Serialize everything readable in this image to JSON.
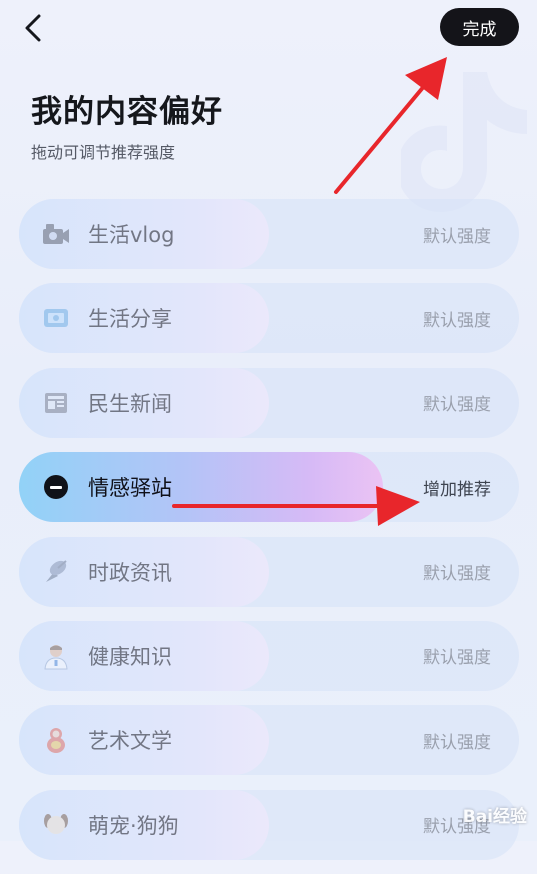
{
  "header": {
    "done_label": "完成"
  },
  "page": {
    "title": "我的内容偏好",
    "subtitle": "拖动可调节推荐强度"
  },
  "preferences": [
    {
      "label": "生活vlog",
      "strength": "默认强度",
      "icon": "camera-icon",
      "active": false
    },
    {
      "label": "生活分享",
      "strength": "默认强度",
      "icon": "photo-share-icon",
      "active": false
    },
    {
      "label": "民生新闻",
      "strength": "默认强度",
      "icon": "newspaper-icon",
      "active": false
    },
    {
      "label": "情感驿站",
      "strength": "增加推荐",
      "icon": "minus-circle-icon",
      "active": true
    },
    {
      "label": "时政资讯",
      "strength": "默认强度",
      "icon": "satellite-icon",
      "active": false
    },
    {
      "label": "健康知识",
      "strength": "默认强度",
      "icon": "doctor-icon",
      "active": false
    },
    {
      "label": "艺术文学",
      "strength": "默认强度",
      "icon": "matryoshka-icon",
      "active": false
    },
    {
      "label": "萌宠·狗狗",
      "strength": "默认强度",
      "icon": "dog-icon",
      "active": false
    }
  ],
  "colors": {
    "accent_start": "#92d2f7",
    "accent_end": "#ebc3f4",
    "arrow": "#e8262b",
    "done_bg": "#141419"
  },
  "watermark": {
    "text": "Bai经验"
  }
}
